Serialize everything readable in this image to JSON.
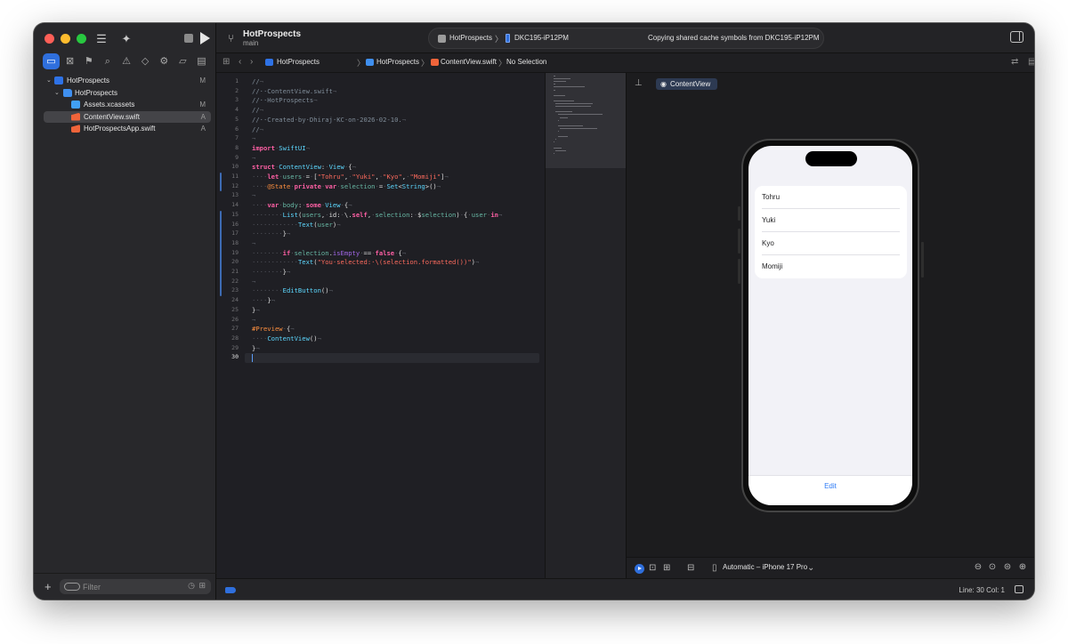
{
  "toolbar": {
    "project_title": "HotProspects",
    "branch": "main",
    "scheme": "HotProspects",
    "device": "DKC195-iP12PM",
    "status_message": "Copying shared cache symbols from DKC195-iP12PM"
  },
  "jumpbar": {
    "crumbs": [
      "HotProspects",
      "HotProspects",
      "ContentView.swift",
      "No Selection"
    ]
  },
  "navigator": {
    "items": [
      {
        "label": "HotProspects",
        "badge": "M",
        "icon": "project-icon"
      },
      {
        "label": "HotProspects",
        "badge": "",
        "icon": "folder-icon"
      },
      {
        "label": "Assets.xcassets",
        "badge": "M",
        "icon": "asset-catalog-icon"
      },
      {
        "label": "ContentView.swift",
        "badge": "A",
        "icon": "swift-file-icon"
      },
      {
        "label": "HotProspectsApp.swift",
        "badge": "A",
        "icon": "swift-file-icon"
      }
    ],
    "filter_placeholder": "Filter"
  },
  "editor": {
    "current_line": 30,
    "line_numbers": [
      "1",
      "2",
      "3",
      "4",
      "5",
      "6",
      "7",
      "8",
      "9",
      "10",
      "11",
      "12",
      "13",
      "14",
      "15",
      "16",
      "17",
      "18",
      "19",
      "20",
      "21",
      "22",
      "23",
      "24",
      "25",
      "26",
      "27",
      "28",
      "29",
      "30"
    ],
    "lines": [
      "//",
      "//  ContentView.swift",
      "//  HotProspects",
      "//",
      "//  Created by Dhiraj KC on 2026-02-10.",
      "//",
      "",
      "import SwiftUI",
      "",
      "struct ContentView: View {",
      "    let users = [\"Tohru\", \"Yuki\", \"Kyo\", \"Momiji\"]",
      "    @State private var selection = Set<String>()",
      "",
      "    var body: some View {",
      "        List(users, id: \\.self, selection: $selection) { user in",
      "            Text(user)",
      "        }",
      "",
      "        if selection.isEmpty == false {",
      "            Text(\"You selected: \\(selection.formatted())\")",
      "        }",
      "",
      "        EditButton()",
      "    }",
      "}",
      "",
      "#Preview {",
      "    ContentView()",
      "}",
      ""
    ]
  },
  "preview": {
    "tab_label": "ContentView",
    "list_items": [
      "Tohru",
      "Yuki",
      "Kyo",
      "Momiji"
    ],
    "edit_button": "Edit",
    "device_selector": "Automatic – iPhone 17 Pro"
  },
  "statusbar": {
    "cursor_position": "Line: 30  Col: 1"
  },
  "colors": {
    "accent": "#2f6fdd",
    "keyword": "#fc5fa3",
    "string": "#fc6a5d",
    "type": "#5dd8ff",
    "comment": "#7f8c98",
    "ios_tint": "#2f7cf6"
  }
}
